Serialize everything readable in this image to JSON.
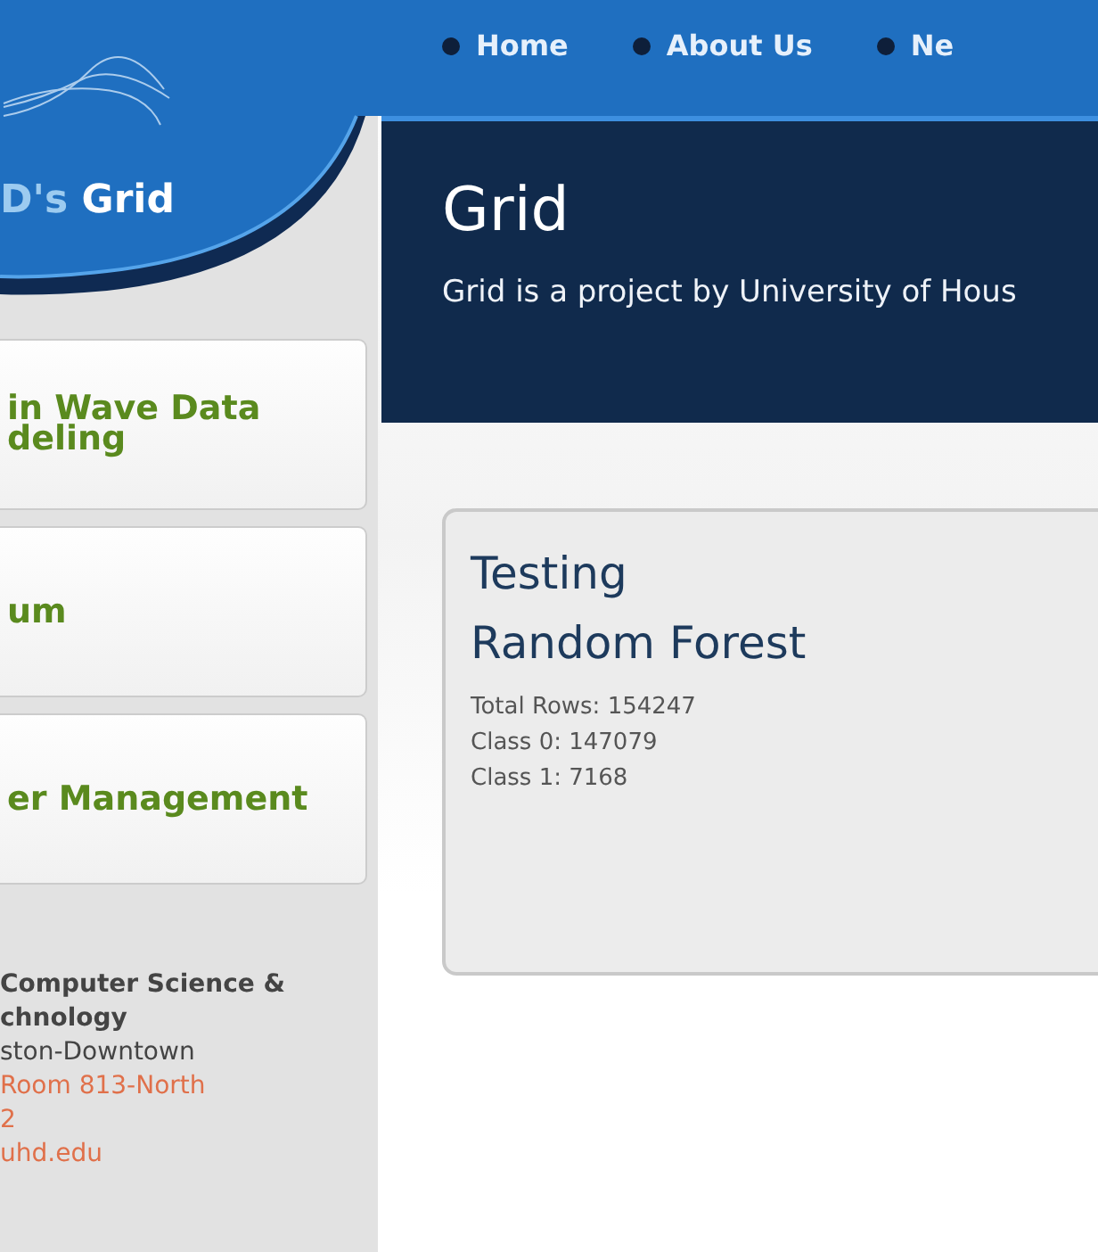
{
  "brand": {
    "prefix": "D's",
    "name": "Grid"
  },
  "nav": [
    {
      "label": "Home"
    },
    {
      "label": "About Us"
    },
    {
      "label": "Ne"
    }
  ],
  "sidebar": {
    "items": [
      {
        "lines": [
          "in Wave Data",
          "deling"
        ]
      },
      {
        "lines": [
          "um"
        ]
      },
      {
        "lines": [
          "er Management"
        ]
      }
    ],
    "contact": [
      {
        "text": "Computer Science &",
        "kind": "bold"
      },
      {
        "text": "chnology",
        "kind": "bold"
      },
      {
        "text": "ston-Downtown",
        "kind": "plain"
      },
      {
        "text": "Room 813-North",
        "kind": "accent"
      },
      {
        "text": "2",
        "kind": "accent"
      },
      {
        "text": "uhd.edu",
        "kind": "accent"
      }
    ]
  },
  "banner": {
    "title": "Grid",
    "subtitle": "Grid is a project by University of Hous"
  },
  "card": {
    "heading": "Testing",
    "subheading": "Random Forest",
    "stats": [
      "Total Rows: 154247",
      "Class 0: 147079",
      "Class 1: 7168"
    ]
  }
}
